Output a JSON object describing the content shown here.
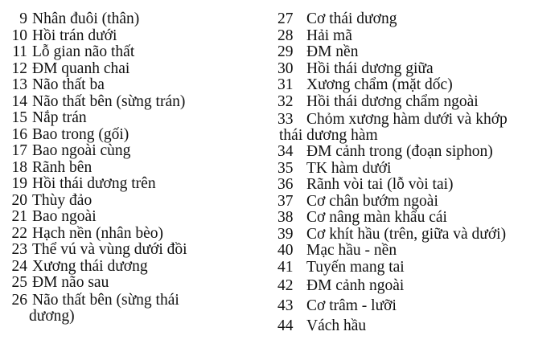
{
  "left_column": [
    {
      "num": "9",
      "label": "Nhân đuôi (thân)"
    },
    {
      "num": "10",
      "label": "Hồi trán dưới"
    },
    {
      "num": "11",
      "label": "Lỗ gian não thất"
    },
    {
      "num": "12",
      "label": "ĐM quanh chai"
    },
    {
      "num": "13",
      "label": "Não thất ba"
    },
    {
      "num": "14",
      "label": "Não thất bên (sừng trán)"
    },
    {
      "num": "15",
      "label": "Nắp trán"
    },
    {
      "num": "16",
      "label": "Bao trong (gối)"
    },
    {
      "num": "17",
      "label": "Bao ngoài cùng"
    },
    {
      "num": "18",
      "label": "Rãnh bên"
    },
    {
      "num": "19",
      "label": "Hồi thái dương trên"
    },
    {
      "num": "20",
      "label": "Thùy đảo"
    },
    {
      "num": "21",
      "label": "Bao ngoài"
    },
    {
      "num": "22",
      "label": "Hạch nền (nhân bèo)"
    },
    {
      "num": "23",
      "label": "Thể vú và vùng dưới đồi"
    },
    {
      "num": "24",
      "label": "Xương thái dương"
    },
    {
      "num": "25",
      "label": "ĐM não sau"
    },
    {
      "num": "26",
      "label": "Não thất bên (sừng thái",
      "continuation": "dương)"
    }
  ],
  "right_column": [
    {
      "num": "27",
      "label": "Cơ thái dương"
    },
    {
      "num": "28",
      "label": "Hải mã"
    },
    {
      "num": "29",
      "label": "ĐM nền"
    },
    {
      "num": "30",
      "label": "Hồi thái dương giữa"
    },
    {
      "num": "31",
      "label": "Xương chẩm (mặt dốc)"
    },
    {
      "num": "32",
      "label": "Hồi thái dương chẩm ngoài"
    },
    {
      "num": "33",
      "label": "Chỏm xương hàm dưới và khớp",
      "continuation": "thái dương hàm"
    },
    {
      "num": "34",
      "label": "ĐM cảnh trong (đoạn siphon)"
    },
    {
      "num": "35",
      "label": "TK hàm dưới"
    },
    {
      "num": "36",
      "label": "Rãnh vòi tai (lỗ vòi tai)"
    },
    {
      "num": "37",
      "label": "Cơ chân bướm ngoài"
    },
    {
      "num": "38",
      "label": "Cơ nâng màn khẩu cái"
    },
    {
      "num": "39",
      "label": "Cơ khít hầu (trên, giữa và dưới)"
    },
    {
      "num": "40",
      "label": "Mạc hầu - nền"
    },
    {
      "num": "41",
      "label": "Tuyến mang tai"
    },
    {
      "num": "42",
      "label": "ĐM cảnh ngoài"
    },
    {
      "num": "43",
      "label": "Cơ trâm - lưỡi"
    },
    {
      "num": "44",
      "label": "Vách hầu"
    }
  ]
}
